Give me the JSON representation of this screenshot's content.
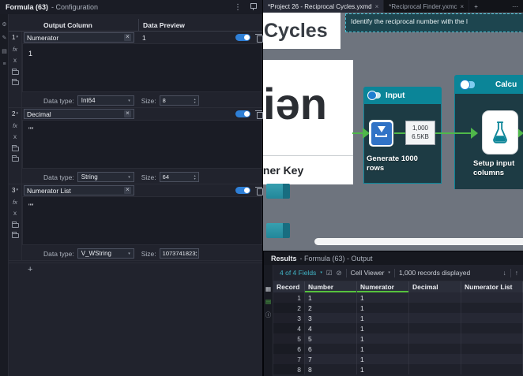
{
  "colors": {
    "accent_teal": "#0b8598",
    "toggle_blue": "#2e7fd6",
    "wire_green": "#4fb84a",
    "selection_teal": "#46c0d4",
    "sort_green": "#56c23d"
  },
  "config_panel": {
    "header": {
      "title_bold": "Formula (63)",
      "title_rest": "- Configuration",
      "kebab": "⋮"
    },
    "side_icons": [
      {
        "name": "wrench-icon",
        "glyph": "⚙"
      },
      {
        "name": "annotation-icon",
        "glyph": "✎"
      },
      {
        "name": "layers-icon",
        "glyph": "▤"
      },
      {
        "name": "list-icon",
        "glyph": "≡"
      }
    ],
    "table": {
      "output_column": "Output Column",
      "data_preview": "Data Preview"
    },
    "labels": {
      "data_type": "Data type:",
      "size": "Size:",
      "fx": "fx",
      "x": "x",
      "chevron": "▾",
      "spin_up": "▴",
      "spin_down": "▾",
      "clear": "×",
      "add": "+"
    },
    "rows": [
      {
        "num": "1",
        "name": "Numerator",
        "preview": "1",
        "expression": "1",
        "data_type": "Int64",
        "size": "8"
      },
      {
        "num": "2",
        "name": "Decimal",
        "preview": "",
        "expression": "\"\"",
        "data_type": "String",
        "size": "64"
      },
      {
        "num": "3",
        "name": "Numerator List",
        "preview": "",
        "expression": "\"\"",
        "data_type": "V_WString",
        "size": "1073741823"
      }
    ]
  },
  "tab_bar": {
    "tabs": [
      {
        "label": "*Project 26 - Reciprocal Cycles.yxmd"
      },
      {
        "label": "*Reciprocal Finder.yxmc"
      }
    ],
    "close": "×",
    "new_tab": "+",
    "overflow": "⋯"
  },
  "canvas": {
    "title_comment": "Cycles",
    "note_comment": "Identify the reciprocal number with the l",
    "image_text": "iən",
    "key_comment": "iner Key",
    "dropdown_caret": "▾",
    "input_container": {
      "label": "Input",
      "tool_label": "Generate 1000 rows",
      "annotation": {
        "line1": "1,000",
        "line2": "6.5KB"
      }
    },
    "calc_container": {
      "label": "Calcu"
    },
    "setup_tool": {
      "label": "Setup input columns"
    }
  },
  "results_panel": {
    "header": {
      "title_bold": "Results",
      "title_rest": "- Formula (63) - Output"
    },
    "toolbar": {
      "fields": "4 of 4 Fields",
      "caret": "▾",
      "check_icon": "☑",
      "slash_icon": "⊘",
      "cell_viewer": "Cell Viewer",
      "records": "1,000 records displayed",
      "down_icon": "↓",
      "up_icon": "↑"
    },
    "side_icons": [
      {
        "name": "data-grid-icon",
        "glyph": "▦"
      },
      {
        "name": "metadata-file-icon",
        "glyph": "▤"
      },
      {
        "name": "info-icon",
        "glyph": "ⓘ"
      }
    ],
    "table": {
      "headers": [
        "Record",
        "Number",
        "Numerator",
        "Decimal",
        "Numerator List"
      ],
      "rows": [
        [
          "1",
          "1",
          "1",
          "",
          ""
        ],
        [
          "2",
          "2",
          "1",
          "",
          ""
        ],
        [
          "3",
          "3",
          "1",
          "",
          ""
        ],
        [
          "4",
          "4",
          "1",
          "",
          ""
        ],
        [
          "5",
          "5",
          "1",
          "",
          ""
        ],
        [
          "6",
          "6",
          "1",
          "",
          ""
        ],
        [
          "7",
          "7",
          "1",
          "",
          ""
        ],
        [
          "8",
          "8",
          "1",
          "",
          ""
        ]
      ]
    }
  }
}
